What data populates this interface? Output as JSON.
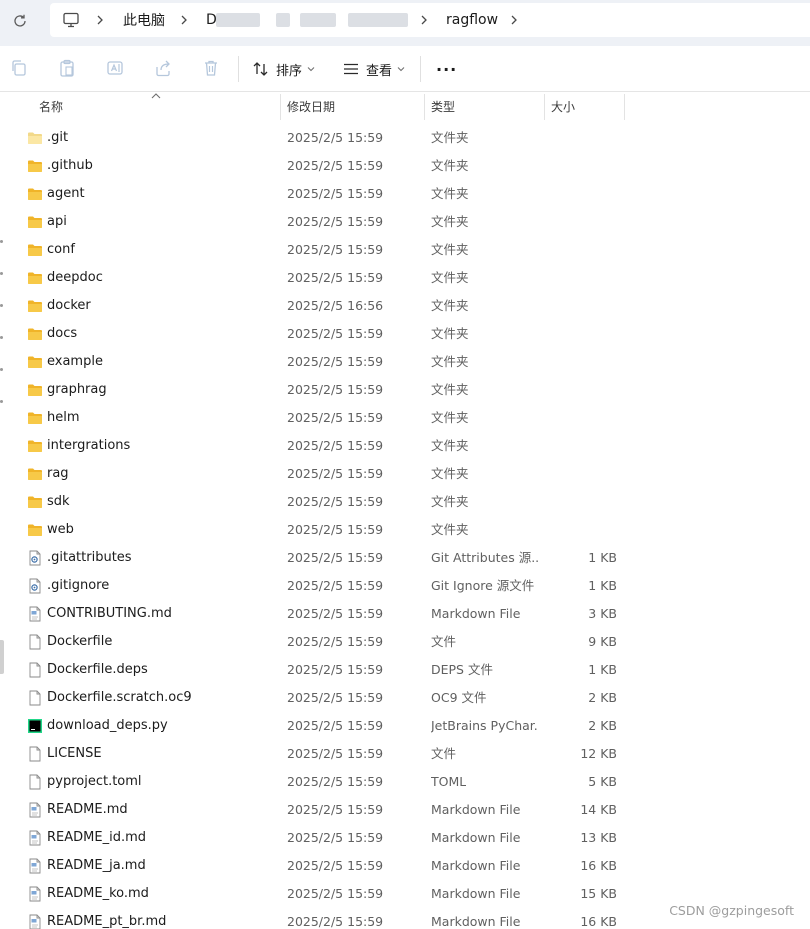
{
  "address_bar": {
    "crumbs": [
      "此电脑",
      "D",
      "ragflow"
    ]
  },
  "toolbar": {
    "sort_label": "排序",
    "view_label": "查看",
    "more_label": "···"
  },
  "columns": {
    "name": "名称",
    "date": "修改日期",
    "type": "类型",
    "size": "大小"
  },
  "files": [
    {
      "name": ".git",
      "date": "2025/2/5 15:59",
      "type": "文件夹",
      "size": "",
      "icon": "folder-light-icon"
    },
    {
      "name": ".github",
      "date": "2025/2/5 15:59",
      "type": "文件夹",
      "size": "",
      "icon": "folder-icon"
    },
    {
      "name": "agent",
      "date": "2025/2/5 15:59",
      "type": "文件夹",
      "size": "",
      "icon": "folder-icon"
    },
    {
      "name": "api",
      "date": "2025/2/5 15:59",
      "type": "文件夹",
      "size": "",
      "icon": "folder-icon"
    },
    {
      "name": "conf",
      "date": "2025/2/5 15:59",
      "type": "文件夹",
      "size": "",
      "icon": "folder-icon"
    },
    {
      "name": "deepdoc",
      "date": "2025/2/5 15:59",
      "type": "文件夹",
      "size": "",
      "icon": "folder-icon"
    },
    {
      "name": "docker",
      "date": "2025/2/5 16:56",
      "type": "文件夹",
      "size": "",
      "icon": "folder-icon"
    },
    {
      "name": "docs",
      "date": "2025/2/5 15:59",
      "type": "文件夹",
      "size": "",
      "icon": "folder-icon"
    },
    {
      "name": "example",
      "date": "2025/2/5 15:59",
      "type": "文件夹",
      "size": "",
      "icon": "folder-icon"
    },
    {
      "name": "graphrag",
      "date": "2025/2/5 15:59",
      "type": "文件夹",
      "size": "",
      "icon": "folder-icon"
    },
    {
      "name": "helm",
      "date": "2025/2/5 15:59",
      "type": "文件夹",
      "size": "",
      "icon": "folder-icon"
    },
    {
      "name": "intergrations",
      "date": "2025/2/5 15:59",
      "type": "文件夹",
      "size": "",
      "icon": "folder-icon"
    },
    {
      "name": "rag",
      "date": "2025/2/5 15:59",
      "type": "文件夹",
      "size": "",
      "icon": "folder-icon"
    },
    {
      "name": "sdk",
      "date": "2025/2/5 15:59",
      "type": "文件夹",
      "size": "",
      "icon": "folder-icon"
    },
    {
      "name": "web",
      "date": "2025/2/5 15:59",
      "type": "文件夹",
      "size": "",
      "icon": "folder-icon"
    },
    {
      "name": ".gitattributes",
      "date": "2025/2/5 15:59",
      "type": "Git Attributes 源...",
      "size": "1 KB",
      "icon": "settings-file-icon"
    },
    {
      "name": ".gitignore",
      "date": "2025/2/5 15:59",
      "type": "Git Ignore 源文件",
      "size": "1 KB",
      "icon": "settings-file-icon"
    },
    {
      "name": "CONTRIBUTING.md",
      "date": "2025/2/5 15:59",
      "type": "Markdown File",
      "size": "3 KB",
      "icon": "markdown-file-icon"
    },
    {
      "name": "Dockerfile",
      "date": "2025/2/5 15:59",
      "type": "文件",
      "size": "9 KB",
      "icon": "blank-file-icon"
    },
    {
      "name": "Dockerfile.deps",
      "date": "2025/2/5 15:59",
      "type": "DEPS 文件",
      "size": "1 KB",
      "icon": "blank-file-icon"
    },
    {
      "name": "Dockerfile.scratch.oc9",
      "date": "2025/2/5 15:59",
      "type": "OC9 文件",
      "size": "2 KB",
      "icon": "blank-file-icon"
    },
    {
      "name": "download_deps.py",
      "date": "2025/2/5 15:59",
      "type": "JetBrains PyChar...",
      "size": "2 KB",
      "icon": "pycharm-file-icon"
    },
    {
      "name": "LICENSE",
      "date": "2025/2/5 15:59",
      "type": "文件",
      "size": "12 KB",
      "icon": "blank-file-icon"
    },
    {
      "name": "pyproject.toml",
      "date": "2025/2/5 15:59",
      "type": "TOML",
      "size": "5 KB",
      "icon": "blank-file-icon"
    },
    {
      "name": "README.md",
      "date": "2025/2/5 15:59",
      "type": "Markdown File",
      "size": "14 KB",
      "icon": "markdown-file-icon"
    },
    {
      "name": "README_id.md",
      "date": "2025/2/5 15:59",
      "type": "Markdown File",
      "size": "13 KB",
      "icon": "markdown-file-icon"
    },
    {
      "name": "README_ja.md",
      "date": "2025/2/5 15:59",
      "type": "Markdown File",
      "size": "16 KB",
      "icon": "markdown-file-icon"
    },
    {
      "name": "README_ko.md",
      "date": "2025/2/5 15:59",
      "type": "Markdown File",
      "size": "15 KB",
      "icon": "markdown-file-icon"
    },
    {
      "name": "README_pt_br.md",
      "date": "2025/2/5 15:59",
      "type": "Markdown File",
      "size": "16 KB",
      "icon": "markdown-file-icon"
    }
  ],
  "watermark": "CSDN @gzpingesoft",
  "colors": {
    "folder": "#f7c948",
    "folder_light": "#fbe7a4",
    "address_bg": "#eef1f6"
  }
}
